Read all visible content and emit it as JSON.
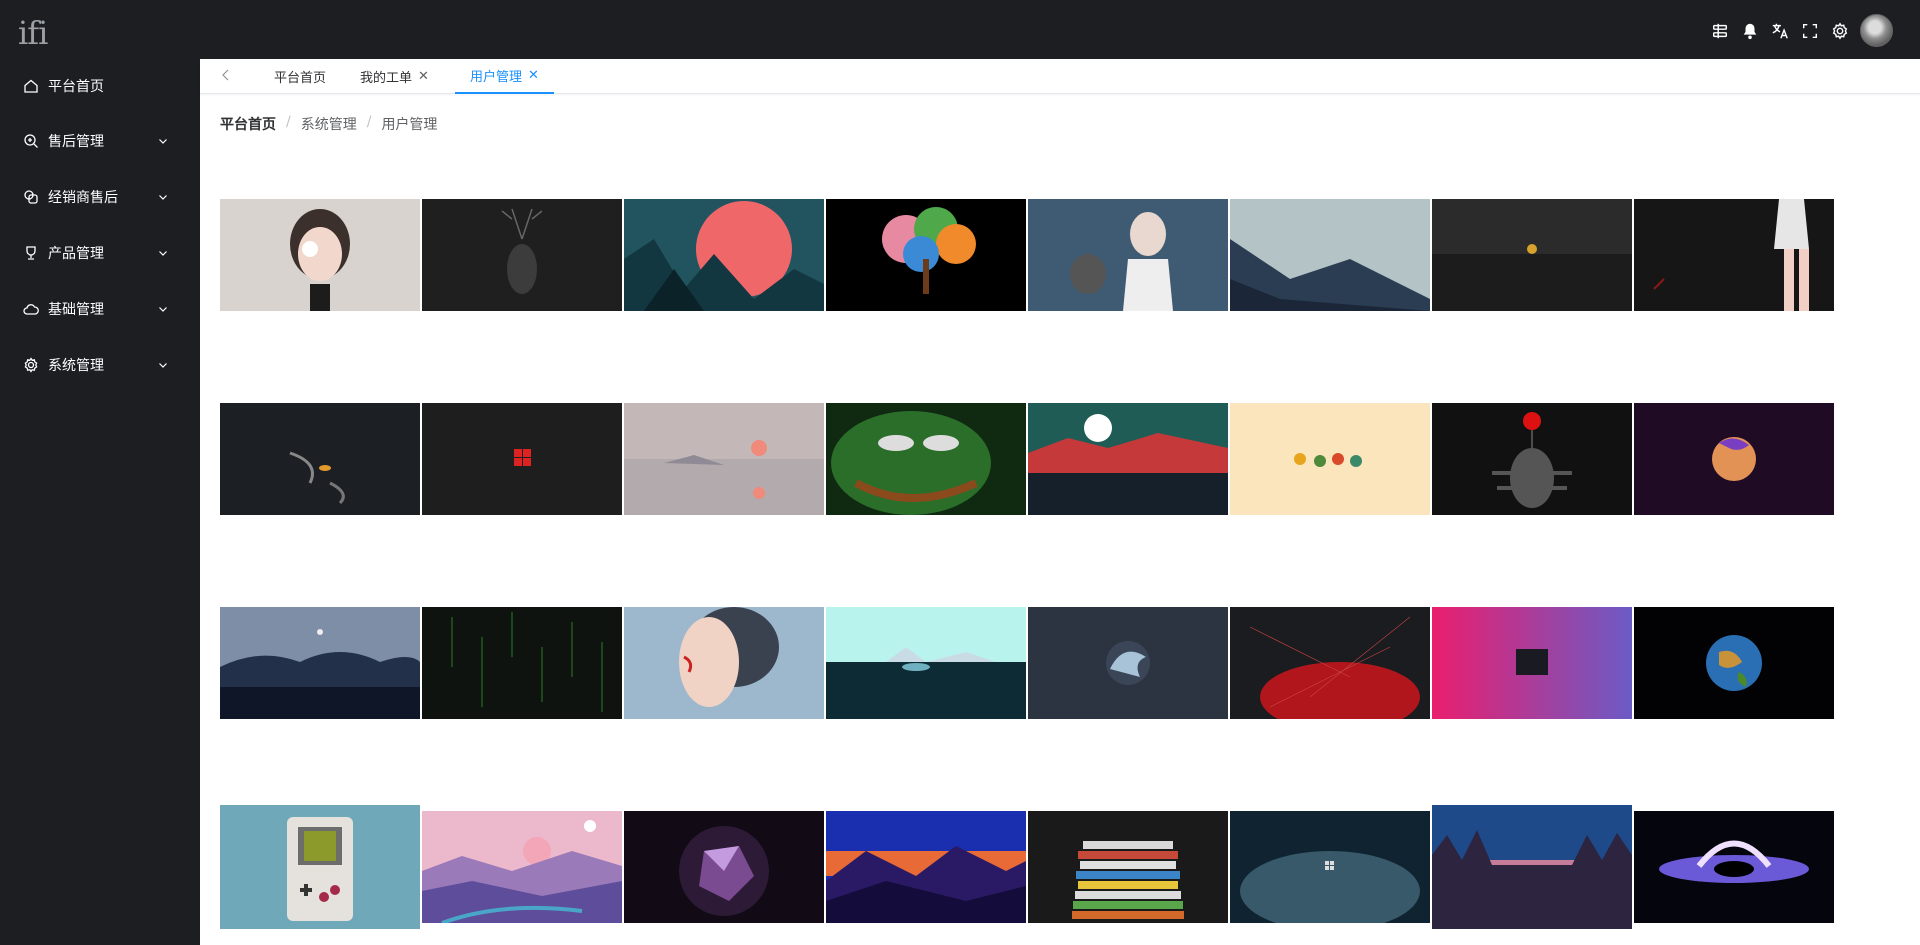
{
  "topbar": {
    "logo": "ifi",
    "icons": [
      "tools-icon",
      "bell-icon",
      "translate-icon",
      "fullscreen-icon",
      "gear-icon"
    ]
  },
  "sidebar": {
    "items": [
      {
        "label": "平台首页",
        "icon": "home-icon",
        "expandable": false
      },
      {
        "label": "售后管理",
        "icon": "search-plus-icon",
        "expandable": true
      },
      {
        "label": "经销商售后",
        "icon": "overlap-icon",
        "expandable": true
      },
      {
        "label": "产品管理",
        "icon": "trophy-icon",
        "expandable": true
      },
      {
        "label": "基础管理",
        "icon": "cloud-icon",
        "expandable": true
      },
      {
        "label": "系统管理",
        "icon": "gear-icon",
        "expandable": true
      }
    ]
  },
  "tabs": [
    {
      "label": "平台首页",
      "closable": false,
      "active": false
    },
    {
      "label": "我的工单",
      "closable": true,
      "active": false
    },
    {
      "label": "用户管理",
      "closable": true,
      "active": true
    }
  ],
  "breadcrumb": [
    "平台首页",
    "系统管理",
    "用户管理"
  ],
  "colors": {
    "sidebar": "#1d1e22",
    "accent": "#1890ff"
  },
  "gallery": {
    "rows": [
      [
        "portrait-girl-eyepatch",
        "deer-dark",
        "red-sun-mountains",
        "colorful-tree",
        "girl-white-shirt",
        "misty-mountains-bird",
        "dark-landscape-moon",
        "red-dress-legs"
      ],
      [
        "koi-fish-dark",
        "windows-logo-red",
        "pink-sunset-lake",
        "pepe-ascii-green",
        "red-hills-moon",
        "tiny-creatures-beige",
        "multi-arm-statue",
        "purple-planet-circle"
      ],
      [
        "night-forest-moon",
        "green-matrix-rain",
        "elf-woman-profile",
        "cyan-sky-lake",
        "great-wave-circle",
        "red-network-lines",
        "pink-purple-gradient-terminal",
        "earth-space"
      ],
      [
        "gameboy",
        "pink-purple-landscape",
        "crystal-polyhedron",
        "blue-mountain-sunset",
        "vhs-tapes-stack",
        "blue-fog-windows",
        "forest-silhouette-sunset",
        "black-hole"
      ]
    ]
  }
}
